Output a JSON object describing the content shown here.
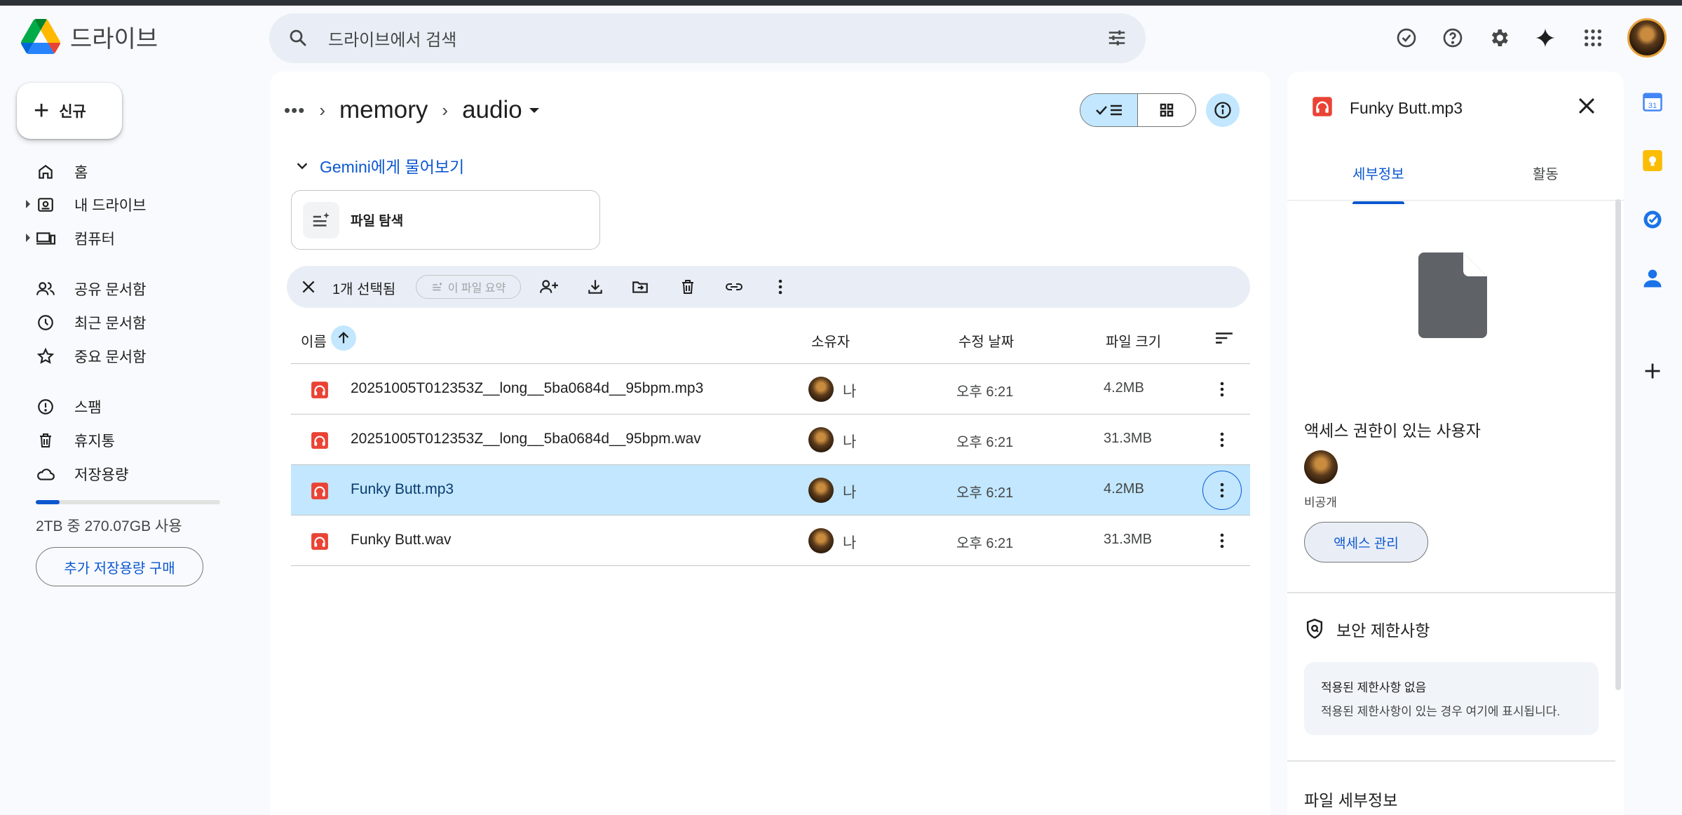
{
  "app": {
    "name": "드라이브"
  },
  "search": {
    "placeholder": "드라이브에서 검색"
  },
  "nav": {
    "new_label": "신규",
    "items": [
      {
        "label": "홈",
        "icon": "home-icon"
      },
      {
        "label": "내 드라이브",
        "icon": "my-drive-icon"
      },
      {
        "label": "컴퓨터",
        "icon": "computer-icon"
      },
      {
        "label": "공유 문서함",
        "icon": "shared-icon"
      },
      {
        "label": "최근 문서함",
        "icon": "clock-icon"
      },
      {
        "label": "중요 문서함",
        "icon": "star-icon"
      },
      {
        "label": "스팸",
        "icon": "spam-icon"
      },
      {
        "label": "휴지통",
        "icon": "trash-icon"
      },
      {
        "label": "저장용량",
        "icon": "cloud-icon"
      }
    ],
    "storage_text": "2TB 중 270.07GB 사용",
    "storage_used_fraction": 0.13,
    "buy_label": "추가 저장용량 구매"
  },
  "breadcrumb": {
    "ellipsis": "•••",
    "folder1": "memory",
    "folder2": "audio"
  },
  "gemini": {
    "label": "Gemini에게 물어보기"
  },
  "explore": {
    "label": "파일 탐색"
  },
  "selection": {
    "count_label": "1개 선택됨",
    "summary_label": "이 파일 요약"
  },
  "table": {
    "headers": {
      "name": "이름",
      "owner": "소유자",
      "modified": "수정 날짜",
      "size": "파일 크기"
    },
    "rows": [
      {
        "name": "20251005T012353Z__long__5ba0684d__95bpm.mp3",
        "owner": "나",
        "modified": "오후 6:21",
        "size": "4.2MB",
        "selected": false
      },
      {
        "name": "20251005T012353Z__long__5ba0684d__95bpm.wav",
        "owner": "나",
        "modified": "오후 6:21",
        "size": "31.3MB",
        "selected": false
      },
      {
        "name": "Funky Butt.mp3",
        "owner": "나",
        "modified": "오후 6:21",
        "size": "4.2MB",
        "selected": true
      },
      {
        "name": "Funky Butt.wav",
        "owner": "나",
        "modified": "오후 6:21",
        "size": "31.3MB",
        "selected": false
      }
    ]
  },
  "details": {
    "title": "Funky Butt.mp3",
    "tab_details": "세부정보",
    "tab_activity": "활동",
    "access_title": "액세스 권한이 있는 사용자",
    "private_label": "비공개",
    "manage_label": "액세스 관리",
    "security_title": "보안 제한사항",
    "restrict_title": "적용된 제한사항 없음",
    "restrict_desc": "적용된 제한사항이 있는 경우 여기에 표시됩니다.",
    "file_details_title": "파일 세부정보"
  },
  "colors": {
    "accent": "#0b57d0",
    "selected_row": "#c2e7ff",
    "audio_icon": "#ea4335"
  }
}
